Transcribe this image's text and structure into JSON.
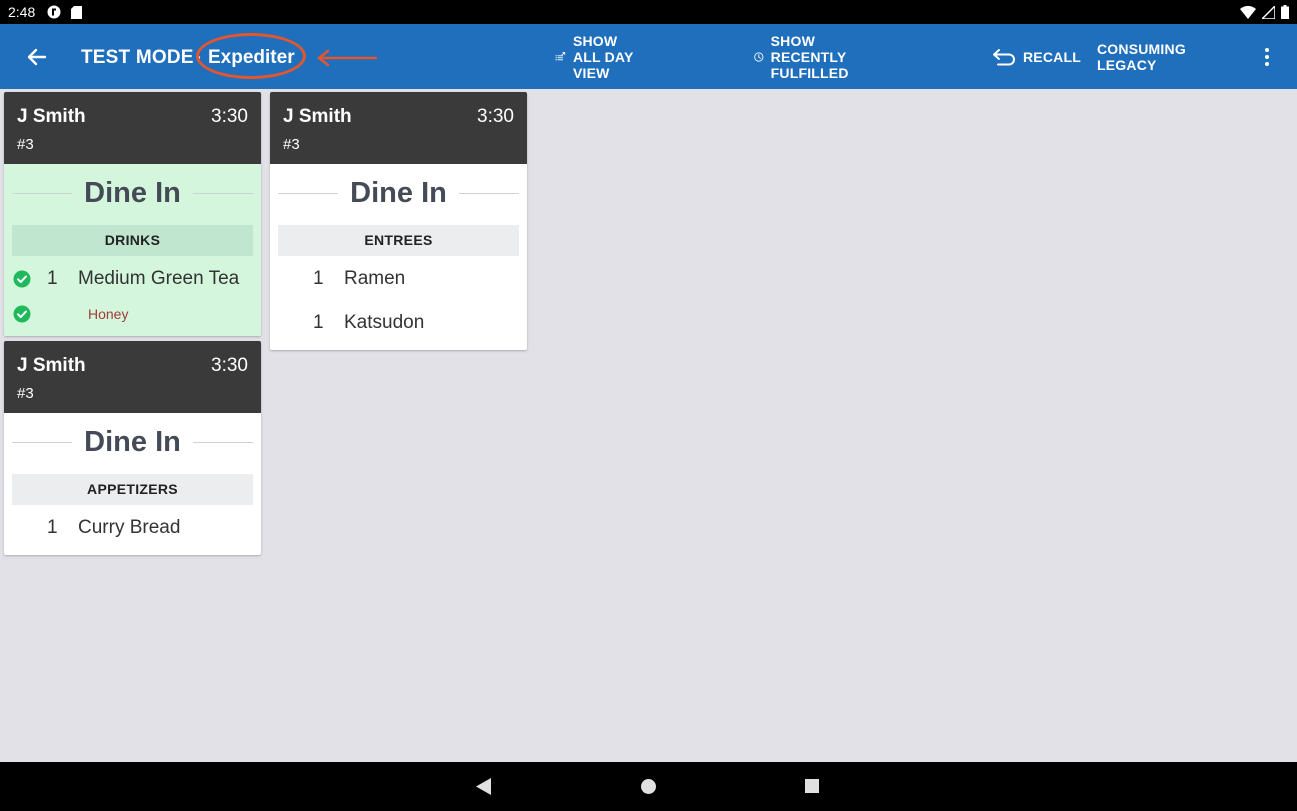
{
  "status_bar": {
    "time": "2:48"
  },
  "app_bar": {
    "mode": "TEST MODE",
    "separator": "·",
    "role": "Expediter",
    "actions": {
      "all_day": "SHOW ALL DAY VIEW",
      "recent": "SHOW RECENTLY FULFILLED",
      "recall": "RECALL",
      "consuming": "CONSUMING LEGACY"
    }
  },
  "tickets": [
    {
      "name": "J Smith",
      "time": "3:30",
      "number": "#3",
      "dining": "Dine In",
      "section": "DRINKS",
      "fulfilled": true,
      "items": [
        {
          "qty": "1",
          "name": "Medium Green Tea",
          "modifier": "Honey"
        }
      ]
    },
    {
      "name": "J Smith",
      "time": "3:30",
      "number": "#3",
      "dining": "Dine In",
      "section": "ENTREES",
      "fulfilled": false,
      "items": [
        {
          "qty": "1",
          "name": "Ramen"
        },
        {
          "qty": "1",
          "name": "Katsudon"
        }
      ]
    },
    {
      "name": "J Smith",
      "time": "3:30",
      "number": "#3",
      "dining": "Dine In",
      "section": "APPETIZERS",
      "fulfilled": false,
      "items": [
        {
          "qty": "1",
          "name": "Curry Bread"
        }
      ]
    }
  ],
  "colors": {
    "app_bar": "#1f6fbd",
    "annotation": "#e4562d",
    "fulfilled": "#d3f6dd",
    "check": "#1fb85a"
  },
  "icons": [
    "back-arrow-icon",
    "list-expand-icon",
    "clock-icon",
    "undo-icon",
    "more-vert-icon"
  ]
}
